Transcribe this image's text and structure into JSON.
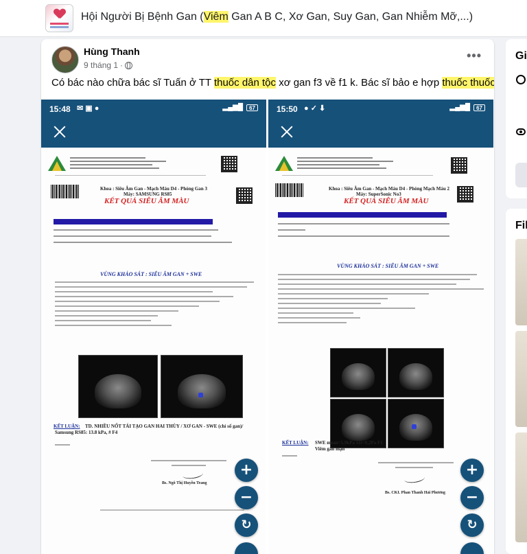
{
  "group": {
    "title_parts": [
      "Hội Người Bị Bệnh Gan (",
      "Viêm",
      " Gan A B C, Xơ Gan, Suy Gan, Gan Nhiễm Mỡ,...)"
    ]
  },
  "post": {
    "author": "Hùng Thanh",
    "time": "9 tháng 1",
    "separator": "·",
    "more": "•••",
    "text_parts": [
      "Có bác nào chữa bác sĩ Tuấn ở TT ",
      "thuốc dân tộc",
      " xơ gan f3 về f1 k. Bác sĩ bảo e hợp ",
      "thuốc thuốc"
    ]
  },
  "screenshots": [
    {
      "time": "15:48",
      "battery": "67",
      "khoa": "Khoa : Siêu Âm Gan - Mạch Máu D4 - Phòng Gan 3",
      "may": "Máy: SAMSUNG RS85",
      "title": "KẾT QUẢ SIÊU ÂM MÀU",
      "region": "VÙNG KHẢO SÁT : SIÊU ÂM GAN + SWE",
      "ket_luan": "KẾT LUẬN:",
      "conclusion_1": "TD. NHIỀU NỐT TÁI TẠO GAN HAI THÙY / XƠ GAN - SWE (chỉ số gan)/",
      "conclusion_2": "Samsung RS85: 13.8 kPa, # F4",
      "doctor": "Bs. Ngô Thị Huyền Trang"
    },
    {
      "time": "15:50",
      "battery": "67",
      "khoa": "Khoa : Siêu Âm Gan - Mạch Máu D4 - Phòng Mạch Máu 2",
      "may": "Máy: SuperSonic No3",
      "title": "KẾT QUẢ SIÊU ÂM MÀU",
      "region": "VÙNG KHẢO SÁT : SIÊU ÂM GAN + SWE",
      "ket_luan": "KẾT LUẬN:",
      "conclusion_1": "SWE mean=5,9kPa SD=0,2Pa F1",
      "conclusion_2": "Viêm gan mạn",
      "doctor": "Bs. CKI. Phan Thanh Hải Phương"
    }
  ],
  "fab": {
    "zoom_in": "+",
    "zoom_out": "−",
    "rotate": "↻"
  },
  "sidebar": {
    "card1_heading": "Gi",
    "card2_heading": "Fil"
  },
  "colors": {
    "highlight": "#fff56b",
    "app_bar": "#16517a",
    "title_red": "#d41e1e"
  }
}
